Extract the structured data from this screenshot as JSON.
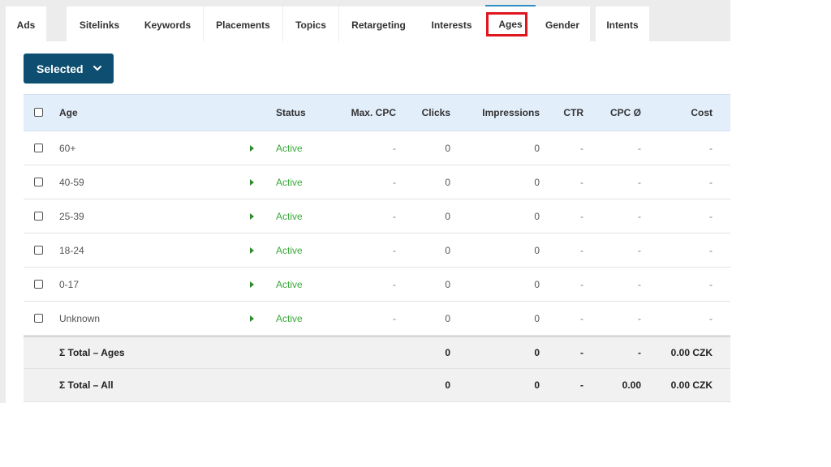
{
  "tabs": [
    "Ads",
    "Sitelinks",
    "Keywords",
    "Placements",
    "Topics",
    "Retargeting",
    "Interests",
    "Ages",
    "Gender",
    "Intents"
  ],
  "active_tab": "Ages",
  "selected_button": {
    "label": "Selected"
  },
  "table": {
    "headers": {
      "age": "Age",
      "status": "Status",
      "max_cpc": "Max. CPC",
      "clicks": "Clicks",
      "impressions": "Impressions",
      "ctr": "CTR",
      "cpc_avg": "CPC Ø",
      "cost": "Cost"
    },
    "rows": [
      {
        "age": "60+",
        "status": "Active",
        "max_cpc": "-",
        "clicks": "0",
        "impressions": "0",
        "ctr": "-",
        "cpc_avg": "-",
        "cost": "-"
      },
      {
        "age": "40-59",
        "status": "Active",
        "max_cpc": "-",
        "clicks": "0",
        "impressions": "0",
        "ctr": "-",
        "cpc_avg": "-",
        "cost": "-"
      },
      {
        "age": "25-39",
        "status": "Active",
        "max_cpc": "-",
        "clicks": "0",
        "impressions": "0",
        "ctr": "-",
        "cpc_avg": "-",
        "cost": "-"
      },
      {
        "age": "18-24",
        "status": "Active",
        "max_cpc": "-",
        "clicks": "0",
        "impressions": "0",
        "ctr": "-",
        "cpc_avg": "-",
        "cost": "-"
      },
      {
        "age": "0-17",
        "status": "Active",
        "max_cpc": "-",
        "clicks": "0",
        "impressions": "0",
        "ctr": "-",
        "cpc_avg": "-",
        "cost": "-"
      },
      {
        "age": "Unknown",
        "status": "Active",
        "max_cpc": "-",
        "clicks": "0",
        "impressions": "0",
        "ctr": "-",
        "cpc_avg": "-",
        "cost": "-"
      }
    ],
    "totals": [
      {
        "label": "Σ Total – Ages",
        "clicks": "0",
        "impressions": "0",
        "ctr": "-",
        "cpc_avg": "-",
        "cost": "0.00 CZK"
      },
      {
        "label": "Σ Total – All",
        "clicks": "0",
        "impressions": "0",
        "ctr": "-",
        "cpc_avg": "0.00",
        "cost": "0.00 CZK"
      }
    ]
  },
  "colors": {
    "button_bg": "#0e4e70",
    "active_status": "#3aa83a",
    "header_bg": "#e3eefb",
    "highlight_box": "#e0161f",
    "active_tab_accent": "#2d8fc4"
  },
  "icons": {
    "dropdown": "chevron-down-icon",
    "status": "play-icon",
    "row_select": "checkbox"
  }
}
